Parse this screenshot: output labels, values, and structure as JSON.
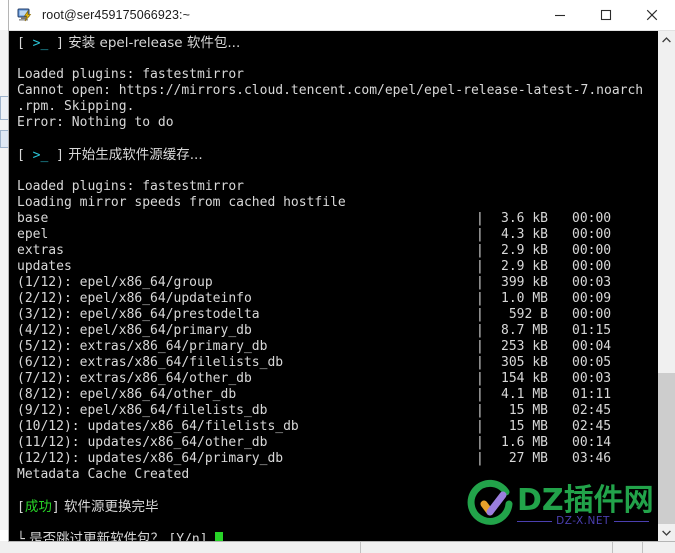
{
  "window": {
    "title": "root@ser459175066923:~",
    "icon": "putty-terminal-icon",
    "minimize_label": "—",
    "maximize_label": "□",
    "close_label": "✕"
  },
  "terminal": {
    "background": "#000000",
    "foreground": "#cfcfcf",
    "accent_cyan": "#2bc6d8",
    "accent_green": "#27d427",
    "cursor_color": "#27d427",
    "lines": [
      {
        "type": "prompt",
        "bracket_open": "[",
        "marker": ">_",
        "bracket_close": "]",
        "text": " 安装 epel-release 软件包..."
      },
      {
        "type": "blank",
        "text": ""
      },
      {
        "type": "plain",
        "text": "Loaded plugins: fastestmirror"
      },
      {
        "type": "plain",
        "text": "Cannot open: https://mirrors.cloud.tencent.com/epel/epel-release-latest-7.noarch"
      },
      {
        "type": "plain",
        "text": ".rpm. Skipping."
      },
      {
        "type": "plain",
        "text": "Error: Nothing to do"
      },
      {
        "type": "blank",
        "text": ""
      },
      {
        "type": "prompt",
        "bracket_open": "[",
        "marker": ">_",
        "bracket_close": "]",
        "text": " 开始生成软件源缓存..."
      },
      {
        "type": "blank",
        "text": ""
      },
      {
        "type": "plain",
        "text": "Loaded plugins: fastestmirror"
      },
      {
        "type": "plain",
        "text": "Loading mirror speeds from cached hostfile"
      },
      {
        "type": "repo",
        "name": "base",
        "size": "3.6 kB",
        "time": "00:00"
      },
      {
        "type": "repo",
        "name": "epel",
        "size": "4.3 kB",
        "time": "00:00"
      },
      {
        "type": "repo",
        "name": "extras",
        "size": "2.9 kB",
        "time": "00:00"
      },
      {
        "type": "repo",
        "name": "updates",
        "size": "2.9 kB",
        "time": "00:00"
      },
      {
        "type": "repo",
        "name": "(1/12): epel/x86_64/group",
        "size": "399 kB",
        "time": "00:03"
      },
      {
        "type": "repo",
        "name": "(2/12): epel/x86_64/updateinfo",
        "size": "1.0 MB",
        "time": "00:09"
      },
      {
        "type": "repo",
        "name": "(3/12): epel/x86_64/prestodelta",
        "size": "592 B",
        "time": "00:00"
      },
      {
        "type": "repo",
        "name": "(4/12): epel/x86_64/primary_db",
        "size": "8.7 MB",
        "time": "01:15"
      },
      {
        "type": "repo",
        "name": "(5/12): extras/x86_64/primary_db",
        "size": "253 kB",
        "time": "00:04"
      },
      {
        "type": "repo",
        "name": "(6/12): extras/x86_64/filelists_db",
        "size": "305 kB",
        "time": "00:05"
      },
      {
        "type": "repo",
        "name": "(7/12): extras/x86_64/other_db",
        "size": "154 kB",
        "time": "00:03"
      },
      {
        "type": "repo",
        "name": "(8/12): epel/x86_64/other_db",
        "size": "4.1 MB",
        "time": "01:11"
      },
      {
        "type": "repo",
        "name": "(9/12): epel/x86_64/filelists_db",
        "size": "15 MB",
        "time": "02:45"
      },
      {
        "type": "repo",
        "name": "(10/12): updates/x86_64/filelists_db",
        "size": "15 MB",
        "time": "02:45"
      },
      {
        "type": "repo",
        "name": "(11/12): updates/x86_64/other_db",
        "size": "1.6 MB",
        "time": "00:14"
      },
      {
        "type": "repo",
        "name": "(12/12): updates/x86_64/primary_db",
        "size": "27 MB",
        "time": "03:46"
      },
      {
        "type": "plain",
        "text": "Metadata Cache Created"
      },
      {
        "type": "blank",
        "text": ""
      },
      {
        "type": "status",
        "bracket_open": "[",
        "marker": "成功",
        "bracket_close": "]",
        "text": " 软件源更换完毕"
      },
      {
        "type": "blank",
        "text": ""
      },
      {
        "type": "question",
        "glyph": "└",
        "text": " 是否跳过更新软件包？ ",
        "choices": "[Y/n]"
      }
    ]
  },
  "scrollbar": {
    "up_arrow": "∧",
    "down_arrow": "∨",
    "thumb_color": "#cdcdcd",
    "track_color": "#f0f0f0"
  },
  "watermark": {
    "brand": "DZ插件网",
    "domain": "DZ-X.NET",
    "ring_color": "#22a34a",
    "check_orange": "#e8a02a",
    "check_purple": "#9b7ede",
    "text_color": "#22a34a",
    "rule_color": "#4b3fb0"
  }
}
